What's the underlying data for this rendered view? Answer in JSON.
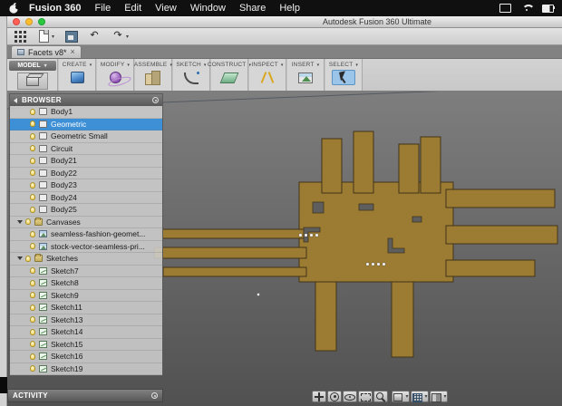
{
  "colors": {
    "accent": "#3d8fd6",
    "gold": "#9c7b33",
    "goldstroke": "#42351a",
    "vp-top": "#7e7e7e",
    "vp-bottom": "#515151",
    "ribbon-bg": "#d6d6d6",
    "select-hl": "#9ac4e8"
  },
  "menubar": {
    "items": [
      {
        "label": "Fusion 360",
        "cls": "bold"
      },
      {
        "label": "File"
      },
      {
        "label": "Edit"
      },
      {
        "label": "View"
      },
      {
        "label": "Window"
      },
      {
        "label": "Share"
      },
      {
        "label": "Help"
      }
    ]
  },
  "titlebar": {
    "title": "Autodesk Fusion 360 Ultimate"
  },
  "qtoolbar": {
    "buttons": [
      {
        "name": "app-launcher",
        "icon": "tb-grid"
      },
      {
        "name": "file-menu",
        "icon": "tb-file",
        "caret": "withcaret"
      },
      {
        "name": "save",
        "icon": "tb-save"
      },
      {
        "name": "undo",
        "icon": "tb-undo",
        "glyph": "↶"
      },
      {
        "name": "redo",
        "icon": "tb-redo",
        "glyph": "↷",
        "caret": "withcaret"
      }
    ]
  },
  "tabbar": {
    "tabs": [
      {
        "label": "Facets v8*",
        "close": "×"
      }
    ]
  },
  "ribbon": {
    "model": {
      "label": "MODEL"
    },
    "groups": [
      {
        "label": "CREATE",
        "icon": "ic-create"
      },
      {
        "label": "MODIFY",
        "icon": "ic-modify"
      },
      {
        "label": "ASSEMBLE",
        "icon": "ic-assemble"
      },
      {
        "label": "SKETCH",
        "icon": "ic-sketch"
      },
      {
        "label": "CONSTRUCT",
        "icon": "ic-construct"
      },
      {
        "label": "INSPECT",
        "icon": "ic-inspect"
      },
      {
        "label": "INSERT",
        "icon": "ic-insert"
      },
      {
        "label": "SELECT",
        "icon": "ic-select",
        "hl": "hl"
      }
    ]
  },
  "browser": {
    "title": "BROWSER",
    "items": [
      {
        "label": "Body1",
        "icon": "ic-body",
        "row": "ind2"
      },
      {
        "label": "Geometric",
        "icon": "ic-body",
        "row": "ind2 selected"
      },
      {
        "label": "Geometric Small",
        "icon": "ic-body",
        "row": "ind2"
      },
      {
        "label": "Circuit",
        "icon": "ic-body",
        "row": "ind2"
      },
      {
        "label": "Body21",
        "icon": "ic-body",
        "row": "ind2"
      },
      {
        "label": "Body22",
        "icon": "ic-body",
        "row": "ind2"
      },
      {
        "label": "Body23",
        "icon": "ic-body",
        "row": "ind2"
      },
      {
        "label": "Body24",
        "icon": "ic-body",
        "row": "ind2"
      },
      {
        "label": "Body25",
        "icon": "ic-body",
        "row": "ind2"
      },
      {
        "label": "Canvases",
        "icon": "ic-folder",
        "row": "ind1 folder"
      },
      {
        "label": "seamless-fashion-geomet...",
        "icon": "ic-canvas",
        "row": "ind2"
      },
      {
        "label": "stock-vector-seamless-pri...",
        "icon": "ic-canvas",
        "row": "ind2"
      },
      {
        "label": "Sketches",
        "icon": "ic-folder",
        "row": "ind1 folder"
      },
      {
        "label": "Sketch7",
        "icon": "ic-sketch-item",
        "row": "ind2"
      },
      {
        "label": "Sketch8",
        "icon": "ic-sketch-item",
        "row": "ind2"
      },
      {
        "label": "Sketch9",
        "icon": "ic-sketch-item",
        "row": "ind2"
      },
      {
        "label": "Sketch11",
        "icon": "ic-sketch-item",
        "row": "ind2"
      },
      {
        "label": "Sketch13",
        "icon": "ic-sketch-item",
        "row": "ind2"
      },
      {
        "label": "Sketch14",
        "icon": "ic-sketch-item",
        "row": "ind2"
      },
      {
        "label": "Sketch15",
        "icon": "ic-sketch-item",
        "row": "ind2"
      },
      {
        "label": "Sketch16",
        "icon": "ic-sketch-item",
        "row": "ind2"
      },
      {
        "label": "Sketch19",
        "icon": "ic-sketch-item",
        "row": "ind2"
      }
    ]
  },
  "activity": {
    "label": "ACTIVITY"
  },
  "navbar": {
    "center": [
      {
        "name": "pan",
        "icon": "nv-pan"
      },
      {
        "name": "orbit",
        "icon": "nv-orbit"
      },
      {
        "name": "look-at",
        "icon": "nv-look"
      },
      {
        "name": "zoom-window",
        "icon": "nv-zoomwin"
      },
      {
        "name": "zoom",
        "icon": "nv-zoom"
      }
    ],
    "right": [
      {
        "name": "display-settings",
        "icon": "nv-display"
      },
      {
        "name": "grid-and-snaps",
        "icon": "nv-grid"
      },
      {
        "name": "viewports",
        "icon": "nv-views"
      }
    ]
  }
}
